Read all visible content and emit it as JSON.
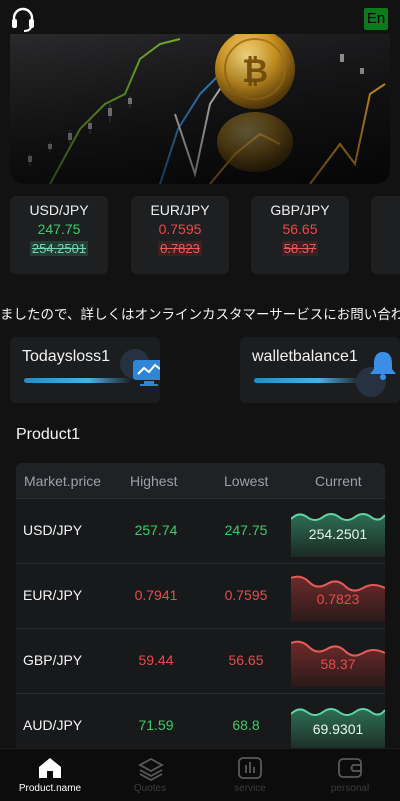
{
  "header": {
    "lang_label": "En"
  },
  "tickers": [
    {
      "symbol": "USD/JPY",
      "price": "247.75",
      "prev": "254.2501",
      "trend": "up"
    },
    {
      "symbol": "EUR/JPY",
      "price": "0.7595",
      "prev": "0.7823",
      "trend": "down"
    },
    {
      "symbol": "GBP/JPY",
      "price": "56.65",
      "prev": "58.37",
      "trend": "down"
    }
  ],
  "notice": "ましたので、詳しくはオンラインカスタマーサービスにお問い合わ",
  "stats": {
    "loss_label": "Todaysloss1",
    "balance_label": "walletbalance1"
  },
  "section_title": "Product1",
  "table": {
    "headers": [
      "Market.price",
      "Highest",
      "Lowest",
      "Current"
    ],
    "rows": [
      {
        "name": "USD/JPY",
        "high": "257.74",
        "low": "247.75",
        "current": "254.2501",
        "trend": "up"
      },
      {
        "name": "EUR/JPY",
        "high": "0.7941",
        "low": "0.7595",
        "current": "0.7823",
        "trend": "down"
      },
      {
        "name": "GBP/JPY",
        "high": "59.44",
        "low": "56.65",
        "current": "58.37",
        "trend": "down"
      },
      {
        "name": "AUD/JPY",
        "high": "71.59",
        "low": "68.8",
        "current": "69.9301",
        "trend": "up"
      }
    ]
  },
  "tabs": [
    {
      "label": "Product.name",
      "icon": "home-icon",
      "active": true
    },
    {
      "label": "Quotes",
      "icon": "layers-icon",
      "active": false
    },
    {
      "label": "service",
      "icon": "chart-box-icon",
      "active": false
    },
    {
      "label": "personal",
      "icon": "wallet-icon",
      "active": false
    }
  ],
  "colors": {
    "up": "#3ccb6a",
    "down": "#ec4a4a",
    "accent": "#2d88c4"
  }
}
